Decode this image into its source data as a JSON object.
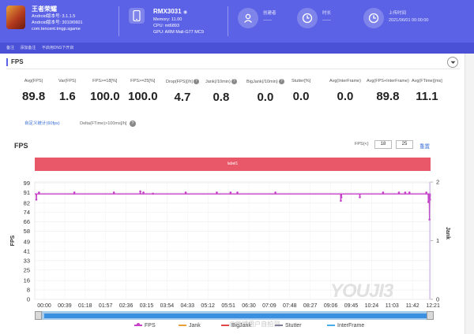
{
  "header": {
    "game_title": "王者荣耀",
    "game_meta": [
      "Android版本号: 3.1.1.5",
      "Android版本号: 3010/0601",
      "com.tencent.tmgp.sgame"
    ],
    "device_name": "RMX3031",
    "device_meta": [
      "Memory: 11.00",
      "CPU: mt6893",
      "GPU: ARM Mali-G77 MC9"
    ],
    "stats": [
      {
        "icon": "user-icon",
        "lines": [
          "创建者",
          "——"
        ]
      },
      {
        "icon": "clock-icon",
        "lines": [
          "时长",
          "——"
        ]
      },
      {
        "icon": "upload-time-icon",
        "lines": [
          "上传时间",
          "2021/06/01 00:00:00"
        ]
      }
    ],
    "colors": {
      "primary": "#5b62e6",
      "subbar": "#4a51d6"
    }
  },
  "subbar": {
    "items": [
      "备注",
      "添加备注",
      "不启用DNS下开启"
    ]
  },
  "section": {
    "title": "FPS"
  },
  "metrics": [
    {
      "label": "Avg(FPS)",
      "value": "89.8",
      "help": false
    },
    {
      "label": "Var(FPS)",
      "value": "1.6",
      "help": false
    },
    {
      "label": "FPS>=18[%]",
      "value": "100.0",
      "help": false
    },
    {
      "label": "FPS>=25[%]",
      "value": "100.0",
      "help": false
    },
    {
      "label": "Drop(FPS)[/h]",
      "value": "4.7",
      "help": true
    },
    {
      "label": "Jank(/10min)",
      "value": "0.8",
      "help": true
    },
    {
      "label": "BigJank(/10min)",
      "value": "0.0",
      "help": true
    },
    {
      "label": "Stutter[%]",
      "value": "0.0",
      "help": false
    },
    {
      "label": "Avg(InterFrame)",
      "value": "0.0",
      "help": false
    },
    {
      "label": "Avg(FPS+InterFrame)",
      "value": "89.8",
      "help": false
    },
    {
      "label": "Avg(FTime)[ms]",
      "value": "11.1",
      "help": false
    }
  ],
  "links": {
    "stats_link": "自定义统计(60fps)",
    "delta_label": "Delta(FTime)>100ms[/h]",
    "help": "?"
  },
  "help_glyph": "?",
  "chart": {
    "title": "FPS",
    "filter_label": "FPS(<)",
    "filter_low": "18",
    "filter_high": "25",
    "reset_label": "重置",
    "band_label": "label1",
    "ylabel_left": "FPS",
    "ylabel_right": "Jank",
    "watermark": "YOUJI3",
    "watermark_sub": "www.youji3.com",
    "weibo_watermark": "@微博用户自拍测",
    "collapse_label": "▾"
  },
  "chart_data": {
    "type": "line",
    "title": "FPS",
    "xlabel": "",
    "ylabel": "FPS",
    "ylabel_right": "Jank",
    "x_ticks": [
      "00:00",
      "00:39",
      "01:18",
      "01:57",
      "02:36",
      "03:15",
      "03:54",
      "04:33",
      "05:12",
      "05:51",
      "06:30",
      "07:09",
      "07:48",
      "08:27",
      "09:06",
      "09:45",
      "10:24",
      "11:03",
      "11:42",
      "12:21"
    ],
    "y_ticks": [
      0,
      8,
      16,
      25,
      33,
      41,
      49,
      58,
      66,
      74,
      82,
      91,
      99
    ],
    "ylim": [
      0,
      100
    ],
    "y2_ticks": [
      0,
      1,
      2
    ],
    "y2lim": [
      0,
      2
    ],
    "grid": true,
    "series": [
      {
        "name": "FPS",
        "color": "#c640c8",
        "baseline": 89.8,
        "duration_s": 750,
        "dips": [
          [
            3,
            85
          ],
          [
            8,
            91
          ],
          [
            75,
            91
          ],
          [
            150,
            91
          ],
          [
            200,
            92
          ],
          [
            206,
            91
          ],
          [
            224,
            90
          ],
          [
            286,
            91
          ],
          [
            345,
            91
          ],
          [
            371,
            91
          ],
          [
            384,
            91
          ],
          [
            456,
            91
          ],
          [
            580,
            84
          ],
          [
            581,
            87
          ],
          [
            616,
            87
          ],
          [
            660,
            91
          ],
          [
            690,
            91
          ],
          [
            702,
            91
          ],
          [
            710,
            91
          ],
          [
            742,
            91
          ],
          [
            746,
            83
          ],
          [
            748,
            68
          ],
          [
            749,
            85
          ]
        ]
      },
      {
        "name": "Jank",
        "color": "#e8a13a",
        "values": []
      },
      {
        "name": "BigJank",
        "color": "#e04848",
        "values": []
      },
      {
        "name": "Stutter",
        "color": "#7a7a9a",
        "values": []
      },
      {
        "name": "InterFrame",
        "color": "#46aee8",
        "values": []
      }
    ],
    "legend_position": "bottom"
  },
  "legend": [
    {
      "name": "FPS",
      "color": "#c640c8",
      "dot": true
    },
    {
      "name": "Jank",
      "color": "#e8a13a",
      "dot": false
    },
    {
      "name": "BigJank",
      "color": "#e04848",
      "dot": false
    },
    {
      "name": "Stutter",
      "color": "#7a7a9a",
      "dot": false
    },
    {
      "name": "InterFrame",
      "color": "#46aee8",
      "dot": false
    }
  ]
}
